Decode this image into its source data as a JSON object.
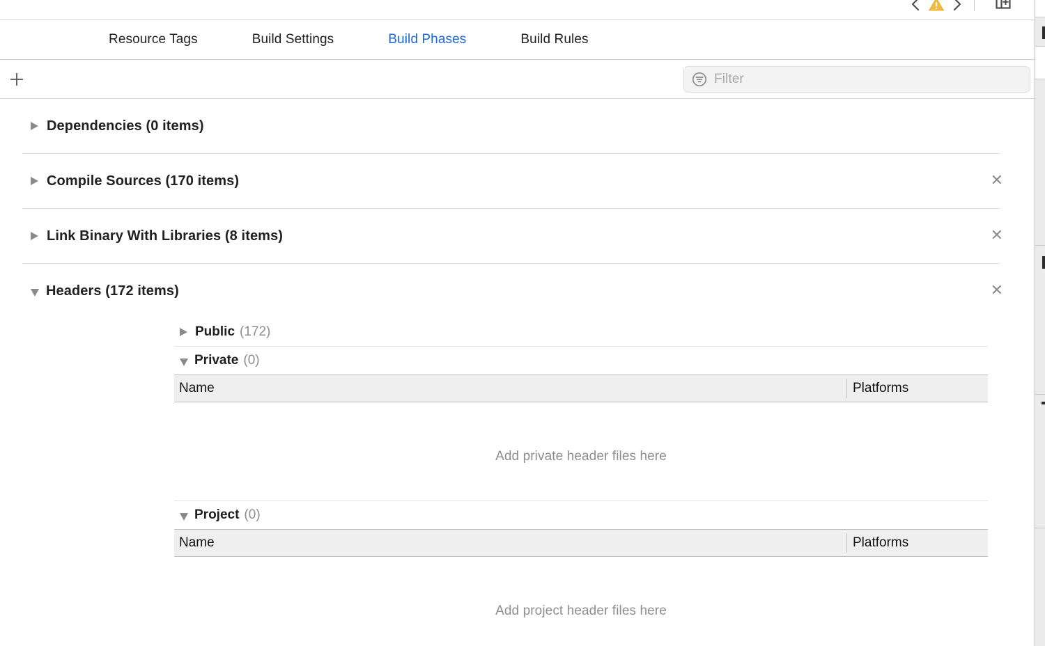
{
  "window": {
    "toolbar": {
      "back_icon": "chevron-left-icon",
      "forward_icon": "chevron-right-icon",
      "warning_icon": "warning-triangle-icon",
      "panel_icon": "add-editor-icon"
    }
  },
  "tabs": [
    {
      "label": "Resource Tags",
      "selected": false
    },
    {
      "label": "Build Settings",
      "selected": false
    },
    {
      "label": "Build Phases",
      "selected": true
    },
    {
      "label": "Build Rules",
      "selected": false
    }
  ],
  "filter_bar": {
    "add_label": "+",
    "add_icon": "plus-icon",
    "filter_icon": "filter-icon",
    "filter_placeholder": "Filter",
    "filter_value": ""
  },
  "phases": [
    {
      "title": "Dependencies (0 items)",
      "expanded": false,
      "removable": false,
      "remove_label": "✕"
    },
    {
      "title": "Compile Sources (170 items)",
      "expanded": false,
      "removable": true,
      "remove_label": "✕"
    },
    {
      "title": "Link Binary With Libraries (8 items)",
      "expanded": false,
      "removable": true,
      "remove_label": "✕"
    },
    {
      "title": "Headers (172 items)",
      "expanded": true,
      "removable": true,
      "remove_label": "✕"
    }
  ],
  "headers_groups": [
    {
      "name": "Public",
      "count": "(172)",
      "expanded": false,
      "has_table": false,
      "empty_message": ""
    },
    {
      "name": "Private",
      "count": "(0)",
      "expanded": true,
      "has_table": true,
      "empty_message": "Add private header files here"
    },
    {
      "name": "Project",
      "count": "(0)",
      "expanded": true,
      "has_table": true,
      "empty_message": "Add project header files here"
    }
  ],
  "table_columns": {
    "name": "Name",
    "platforms": "Platforms"
  },
  "colors": {
    "accent_blue": "#1766dd",
    "warning_yellow": "#f0b429",
    "text": "#1f1f1f",
    "muted": "#8d8d8d",
    "table_header_bg": "#efefef"
  }
}
